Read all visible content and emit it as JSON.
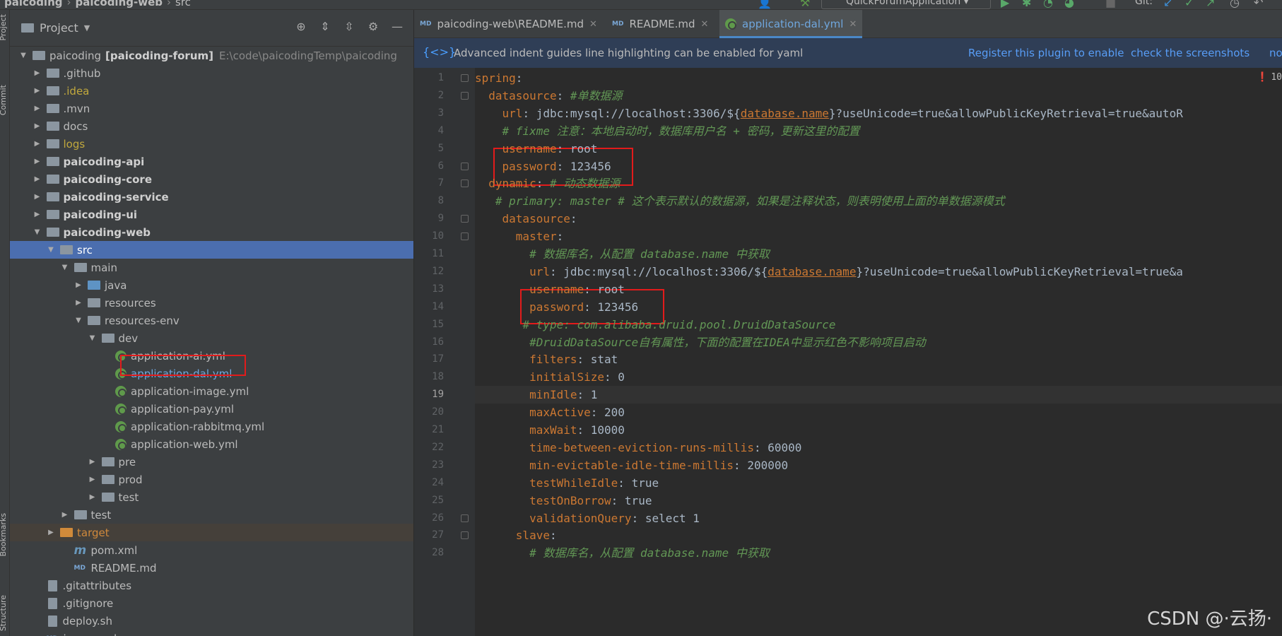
{
  "breadcrumbs": [
    "paicoding",
    "paicoding-web",
    "src"
  ],
  "run_config": "QuickForumApplication",
  "git_label": "Git:",
  "left_strip": [
    "Project",
    "Commit",
    "Bookmarks",
    "Structure"
  ],
  "project_panel": {
    "title": "Project",
    "tree": [
      {
        "label": "paicoding",
        "suffix": "[paicoding-forum]",
        "hint": "E:\\code\\paicodingTemp\\paicoding",
        "depth": 0,
        "arrow": "down",
        "icon": "module"
      },
      {
        "label": ".github",
        "depth": 1,
        "arrow": "right",
        "icon": "folder"
      },
      {
        "label": ".idea",
        "depth": 1,
        "arrow": "right",
        "icon": "folder",
        "color": "yellow"
      },
      {
        "label": ".mvn",
        "depth": 1,
        "arrow": "right",
        "icon": "folder"
      },
      {
        "label": "docs",
        "depth": 1,
        "arrow": "right",
        "icon": "folder"
      },
      {
        "label": "logs",
        "depth": 1,
        "arrow": "right",
        "icon": "folder",
        "color": "yellow"
      },
      {
        "label": "paicoding-api",
        "depth": 1,
        "arrow": "right",
        "icon": "module",
        "bold": true
      },
      {
        "label": "paicoding-core",
        "depth": 1,
        "arrow": "right",
        "icon": "module",
        "bold": true
      },
      {
        "label": "paicoding-service",
        "depth": 1,
        "arrow": "right",
        "icon": "module",
        "bold": true
      },
      {
        "label": "paicoding-ui",
        "depth": 1,
        "arrow": "right",
        "icon": "module",
        "bold": true
      },
      {
        "label": "paicoding-web",
        "depth": 1,
        "arrow": "down",
        "icon": "module",
        "bold": true
      },
      {
        "label": "src",
        "depth": 2,
        "arrow": "down",
        "icon": "folder",
        "selected": true
      },
      {
        "label": "main",
        "depth": 3,
        "arrow": "down",
        "icon": "folder"
      },
      {
        "label": "java",
        "depth": 4,
        "arrow": "right",
        "icon": "folder-blue"
      },
      {
        "label": "resources",
        "depth": 4,
        "arrow": "right",
        "icon": "folder"
      },
      {
        "label": "resources-env",
        "depth": 4,
        "arrow": "down",
        "icon": "folder"
      },
      {
        "label": "dev",
        "depth": 5,
        "arrow": "down",
        "icon": "folder"
      },
      {
        "label": "application-ai.yml",
        "depth": 6,
        "arrow": "",
        "icon": "yml"
      },
      {
        "label": "application-dal.yml",
        "depth": 6,
        "arrow": "",
        "icon": "yml",
        "highlight": true,
        "color": "blue"
      },
      {
        "label": "application-image.yml",
        "depth": 6,
        "arrow": "",
        "icon": "yml"
      },
      {
        "label": "application-pay.yml",
        "depth": 6,
        "arrow": "",
        "icon": "yml"
      },
      {
        "label": "application-rabbitmq.yml",
        "depth": 6,
        "arrow": "",
        "icon": "yml"
      },
      {
        "label": "application-web.yml",
        "depth": 6,
        "arrow": "",
        "icon": "yml"
      },
      {
        "label": "pre",
        "depth": 5,
        "arrow": "right",
        "icon": "folder"
      },
      {
        "label": "prod",
        "depth": 5,
        "arrow": "right",
        "icon": "folder"
      },
      {
        "label": "test",
        "depth": 5,
        "arrow": "right",
        "icon": "folder"
      },
      {
        "label": "test",
        "depth": 3,
        "arrow": "right",
        "icon": "folder"
      },
      {
        "label": "target",
        "depth": 2,
        "arrow": "right",
        "icon": "folder-orange",
        "color": "orange",
        "target": true
      },
      {
        "label": "pom.xml",
        "depth": 3,
        "arrow": "",
        "icon": "m"
      },
      {
        "label": "README.md",
        "depth": 3,
        "arrow": "",
        "icon": "md"
      },
      {
        "label": ".gitattributes",
        "depth": 1,
        "arrow": "",
        "icon": "file"
      },
      {
        "label": ".gitignore",
        "depth": 1,
        "arrow": "",
        "icon": "file"
      },
      {
        "label": "deploy.sh",
        "depth": 1,
        "arrow": "",
        "icon": "file"
      },
      {
        "label": "image.md",
        "depth": 1,
        "arrow": "",
        "icon": "md"
      }
    ]
  },
  "tabs": [
    {
      "label": "paicoding-web\\README.md",
      "icon": "MD"
    },
    {
      "label": "README.md",
      "icon": "MD"
    },
    {
      "label": "application-dal.yml",
      "icon": "yml",
      "active": true
    }
  ],
  "notice": {
    "text": "Advanced indent guides line highlighting can be enabled for yaml",
    "link1": "Register this plugin to enable",
    "link2": "check the screenshots",
    "link3": "no"
  },
  "error_badge": "10",
  "current_line": 19,
  "code_lines": [
    [
      {
        "t": "k",
        "s": "spring"
      },
      {
        "t": "v",
        "s": ":"
      }
    ],
    [
      {
        "t": "v",
        "s": "  "
      },
      {
        "t": "k",
        "s": "datasource"
      },
      {
        "t": "v",
        "s": ": "
      },
      {
        "t": "c",
        "s": "#单数据源"
      }
    ],
    [
      {
        "t": "v",
        "s": "    "
      },
      {
        "t": "k",
        "s": "url"
      },
      {
        "t": "v",
        "s": ": jdbc:mysql://localhost:3306/${"
      },
      {
        "t": "u",
        "s": "database.name"
      },
      {
        "t": "v",
        "s": "}?useUnicode=true&allowPublicKeyRetrieval=true&autoR"
      }
    ],
    [
      {
        "t": "v",
        "s": "    "
      },
      {
        "t": "c",
        "s": "# fixme 注意：本地启动时，数据库用户名 + 密码，更新这里的配置"
      }
    ],
    [
      {
        "t": "v",
        "s": "    "
      },
      {
        "t": "k",
        "s": "username"
      },
      {
        "t": "v",
        "s": ": root"
      }
    ],
    [
      {
        "t": "v",
        "s": "    "
      },
      {
        "t": "k",
        "s": "password"
      },
      {
        "t": "v",
        "s": ": 123456"
      }
    ],
    [
      {
        "t": "v",
        "s": "  "
      },
      {
        "t": "k",
        "s": "dynamic"
      },
      {
        "t": "v",
        "s": ": "
      },
      {
        "t": "c",
        "s": "# 动态数据源"
      }
    ],
    [
      {
        "t": "v",
        "s": "   "
      },
      {
        "t": "c",
        "s": "# primary: master # 这个表示默认的数据源，如果是注释状态，则表明使用上面的单数据源模式"
      }
    ],
    [
      {
        "t": "v",
        "s": "    "
      },
      {
        "t": "k",
        "s": "datasource"
      },
      {
        "t": "v",
        "s": ":"
      }
    ],
    [
      {
        "t": "v",
        "s": "      "
      },
      {
        "t": "k",
        "s": "master"
      },
      {
        "t": "v",
        "s": ":"
      }
    ],
    [
      {
        "t": "v",
        "s": "        "
      },
      {
        "t": "c",
        "s": "# 数据库名，从配置 database.name 中获取"
      }
    ],
    [
      {
        "t": "v",
        "s": "        "
      },
      {
        "t": "k",
        "s": "url"
      },
      {
        "t": "v",
        "s": ": jdbc:mysql://localhost:3306/${"
      },
      {
        "t": "u",
        "s": "database.name"
      },
      {
        "t": "v",
        "s": "}?useUnicode=true&allowPublicKeyRetrieval=true&a"
      }
    ],
    [
      {
        "t": "v",
        "s": "        "
      },
      {
        "t": "k",
        "s": "username"
      },
      {
        "t": "v",
        "s": ": root"
      }
    ],
    [
      {
        "t": "v",
        "s": "        "
      },
      {
        "t": "k",
        "s": "password"
      },
      {
        "t": "v",
        "s": ": 123456"
      }
    ],
    [
      {
        "t": "v",
        "s": "       "
      },
      {
        "t": "c",
        "s": "# type: com.alibaba.druid.pool.DruidDataSource"
      }
    ],
    [
      {
        "t": "v",
        "s": "        "
      },
      {
        "t": "c",
        "s": "#DruidDataSource自有属性，下面的配置在IDEA中显示红色不影响项目启动"
      }
    ],
    [
      {
        "t": "v",
        "s": "        "
      },
      {
        "t": "k",
        "s": "filters"
      },
      {
        "t": "v",
        "s": ": stat"
      }
    ],
    [
      {
        "t": "v",
        "s": "        "
      },
      {
        "t": "k",
        "s": "initialSize"
      },
      {
        "t": "v",
        "s": ": 0"
      }
    ],
    [
      {
        "t": "v",
        "s": "        "
      },
      {
        "t": "k",
        "s": "minIdle"
      },
      {
        "t": "v",
        "s": ": 1"
      }
    ],
    [
      {
        "t": "v",
        "s": "        "
      },
      {
        "t": "k",
        "s": "maxActive"
      },
      {
        "t": "v",
        "s": ": 200"
      }
    ],
    [
      {
        "t": "v",
        "s": "        "
      },
      {
        "t": "k",
        "s": "maxWait"
      },
      {
        "t": "v",
        "s": ": 10000"
      }
    ],
    [
      {
        "t": "v",
        "s": "        "
      },
      {
        "t": "k",
        "s": "time-between-eviction-runs-millis"
      },
      {
        "t": "v",
        "s": ": 60000"
      }
    ],
    [
      {
        "t": "v",
        "s": "        "
      },
      {
        "t": "k",
        "s": "min-evictable-idle-time-millis"
      },
      {
        "t": "v",
        "s": ": 200000"
      }
    ],
    [
      {
        "t": "v",
        "s": "        "
      },
      {
        "t": "k",
        "s": "testWhileIdle"
      },
      {
        "t": "v",
        "s": ": true"
      }
    ],
    [
      {
        "t": "v",
        "s": "        "
      },
      {
        "t": "k",
        "s": "testOnBorrow"
      },
      {
        "t": "v",
        "s": ": true"
      }
    ],
    [
      {
        "t": "v",
        "s": "        "
      },
      {
        "t": "k",
        "s": "validationQuery"
      },
      {
        "t": "v",
        "s": ": select 1"
      }
    ],
    [
      {
        "t": "v",
        "s": "      "
      },
      {
        "t": "k",
        "s": "slave"
      },
      {
        "t": "v",
        "s": ":"
      }
    ],
    [
      {
        "t": "v",
        "s": "        "
      },
      {
        "t": "c",
        "s": "# 数据库名，从配置 database.name 中获取"
      }
    ]
  ],
  "watermark": "CSDN @·云扬·"
}
